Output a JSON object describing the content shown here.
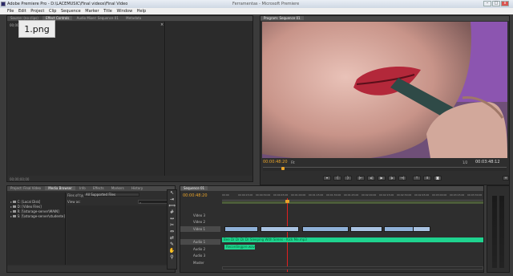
{
  "app": {
    "title": "Adobe Premiere Pro - D:\\LACEMUSIC\\Final videos\\Final Video",
    "center_text": "Ferramentas  -  Microsoft Premiere"
  },
  "menu": [
    "File",
    "Edit",
    "Project",
    "Clip",
    "Sequence",
    "Marker",
    "Title",
    "Window",
    "Help"
  ],
  "source_panel": {
    "tabs": [
      "Source: (no clips)",
      "Effect Controls",
      "Audio Mixer: Sequence 01",
      "Metadata"
    ],
    "timecode": "00;00;00;00",
    "bottom_timecode": "00;00;00;00"
  },
  "overlay_label": "1.png",
  "program_monitor": {
    "tab": "Program: Sequence 01",
    "timecode": "00:00:48:20",
    "fit": "Fit",
    "fraction": "1/2",
    "end_timecode": "00:03:48:12"
  },
  "project_panel": {
    "tabs": [
      "Project: Final Video",
      "Media Browser",
      "Info",
      "Effects",
      "Markers",
      "History"
    ],
    "files_of_type_label": "Files of type:",
    "files_of_type_value": "All Supported Files",
    "view_as_label": "View as:",
    "drives": [
      "C: [Local Disk]",
      "D: [Video Files]",
      "R: [\\\\storage-server\\MAIN]",
      "S: [\\\\storage-server\\studente]"
    ]
  },
  "sequence": {
    "tab": "Sequence 01",
    "timecode": "00:00:48:20",
    "ruler": [
      "00:00",
      "00:00:15:00",
      "00:00:30:00",
      "00:00:45:00",
      "00:01:00:00",
      "00:01:15:00",
      "00:01:30:00",
      "00:01:45:00",
      "00:02:00:00",
      "00:02:15:00",
      "00:02:30:00",
      "00:02:45:00",
      "00:03:00:00",
      "00:03:15:00",
      "00:03:30:00"
    ],
    "video_tracks": [
      "Video 3",
      "Video 2",
      "Video 1"
    ],
    "audio_tracks": [
      "Audio 1",
      "Audio 2",
      "Audio 3",
      "Master"
    ],
    "audio_clip_1": "Bee  Dr  Dr  Dr  Dr  Sleeping With Sirens - Kick Me.mp3",
    "audio_clip_2": "Recordingpre.wav"
  },
  "colors": {
    "timecode": "#e8a32a",
    "video_clip": "#8fb1d8",
    "audio_clip": "#1fd38f",
    "playhead": "#e02020"
  }
}
